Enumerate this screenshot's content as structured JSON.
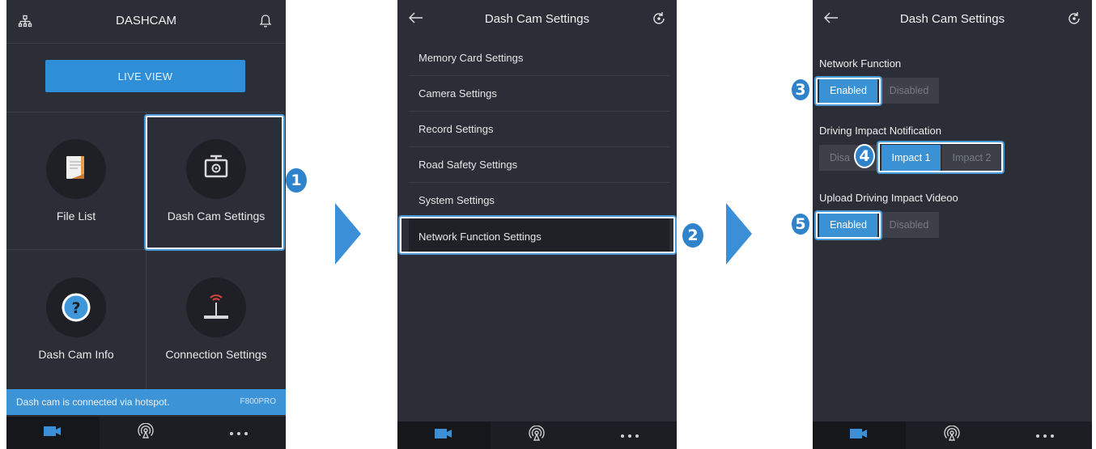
{
  "phone1": {
    "title": "DASHCAM",
    "live_view": "LIVE VIEW",
    "tiles": [
      {
        "label": "File List",
        "icon": "file-list-icon"
      },
      {
        "label": "Dash Cam Settings",
        "icon": "dashcam-settings-icon"
      },
      {
        "label": "Dash Cam Info",
        "icon": "question-icon"
      },
      {
        "label": "Connection Settings",
        "icon": "router-icon"
      }
    ],
    "status": {
      "message": "Dash cam is connected via hotspot.",
      "model": "F800PRO"
    }
  },
  "phone2": {
    "title": "Dash Cam Settings",
    "menu": [
      "Memory Card Settings",
      "Camera Settings",
      "Record Settings",
      "Road Safety Settings",
      "System Settings",
      "Network Function Settings"
    ]
  },
  "phone3": {
    "title": "Dash Cam Settings",
    "network": {
      "label": "Network Function",
      "enabled": "Enabled",
      "disabled": "Disabled"
    },
    "impact": {
      "label": "Driving Impact Notification",
      "disabled": "Disa",
      "impact1": "Impact 1",
      "impact2": "Impact 2"
    },
    "upload": {
      "label": "Upload Driving Impact Videoo",
      "enabled": "Enabled",
      "disabled": "Disabled"
    }
  },
  "steps": [
    "1",
    "2",
    "3",
    "4",
    "5"
  ],
  "colors": {
    "accent": "#3b8fd7",
    "background": "#2b2e36",
    "bottom_nav": "#1c1e23"
  }
}
